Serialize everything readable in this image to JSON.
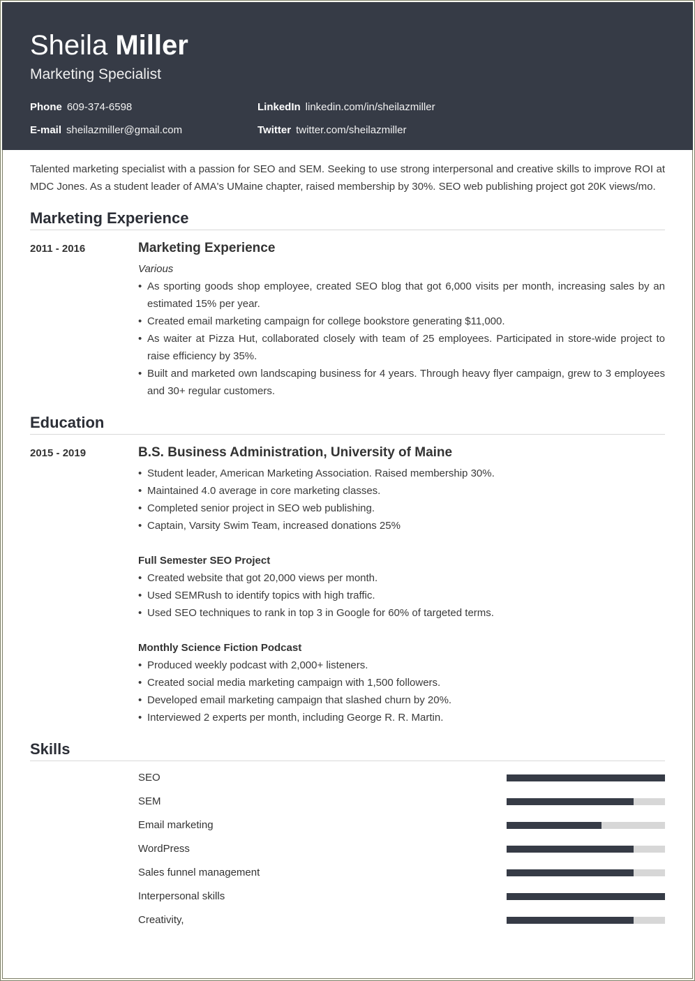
{
  "header": {
    "first_name": "Sheila",
    "last_name": "Miller",
    "title": "Marketing Specialist",
    "contacts": {
      "phone": {
        "label": "Phone",
        "value": "609-374-6598"
      },
      "email": {
        "label": "E-mail",
        "value": "sheilazmiller@gmail.com"
      },
      "linkedin": {
        "label": "LinkedIn",
        "value": "linkedin.com/in/sheilazmiller"
      },
      "twitter": {
        "label": "Twitter",
        "value": "twitter.com/sheilazmiller"
      }
    }
  },
  "summary": "Talented marketing specialist with a passion for SEO and SEM. Seeking to use strong interpersonal and creative skills to improve ROI at MDC Jones. As a student leader of AMA's UMaine chapter, raised membership by 30%. SEO web publishing project got 20K views/mo.",
  "experience": {
    "heading": "Marketing Experience",
    "entries": [
      {
        "dates": "2011 - 2016",
        "title": "Marketing Experience",
        "company": "Various",
        "bullets": [
          "As sporting goods shop employee, created SEO blog that got 6,000 visits per month, increasing sales by an estimated 15% per year.",
          "Created email marketing campaign for college bookstore generating $11,000.",
          "As waiter at Pizza Hut, collaborated closely with team of 25 employees. Participated in store-wide project to raise efficiency by 35%.",
          "Built and marketed own landscaping business for 4 years. Through heavy flyer campaign, grew to 3 employees and 30+ regular customers."
        ]
      }
    ]
  },
  "education": {
    "heading": "Education",
    "entries": [
      {
        "dates": "2015 - 2019",
        "title": "B.S. Business Administration, University of Maine",
        "bullets": [
          "Student leader, American Marketing Association. Raised membership 30%.",
          "Maintained 4.0 average in core marketing classes.",
          "Completed senior project in SEO web publishing.",
          "Captain, Varsity Swim Team, increased donations 25%"
        ],
        "projects": [
          {
            "title": "Full Semester SEO Project",
            "bullets": [
              "Created website that got 20,000 views per month.",
              "Used SEMRush to identify topics with high traffic.",
              "Used SEO techniques to rank in top 3 in Google for 60% of targeted terms."
            ]
          },
          {
            "title": "Monthly Science Fiction Podcast",
            "bullets": [
              "Produced weekly podcast with 2,000+ listeners.",
              "Created social media marketing campaign with 1,500 followers.",
              "Developed email marketing campaign that slashed churn by 20%.",
              "Interviewed 2 experts per month, including George R. R. Martin."
            ]
          }
        ]
      }
    ]
  },
  "skills": {
    "heading": "Skills",
    "items": [
      {
        "name": "SEO",
        "level_percent": 100
      },
      {
        "name": "SEM",
        "level_percent": 80
      },
      {
        "name": "Email marketing",
        "level_percent": 60
      },
      {
        "name": "WordPress",
        "level_percent": 80
      },
      {
        "name": "Sales funnel management",
        "level_percent": 80
      },
      {
        "name": "Interpersonal skills",
        "level_percent": 100
      },
      {
        "name": "Creativity,",
        "level_percent": 80
      }
    ]
  },
  "colors": {
    "header_bg": "#363b46",
    "bar_fill": "#363b46",
    "bar_track": "#d7d7d7",
    "frame": "#7d7f6a"
  }
}
